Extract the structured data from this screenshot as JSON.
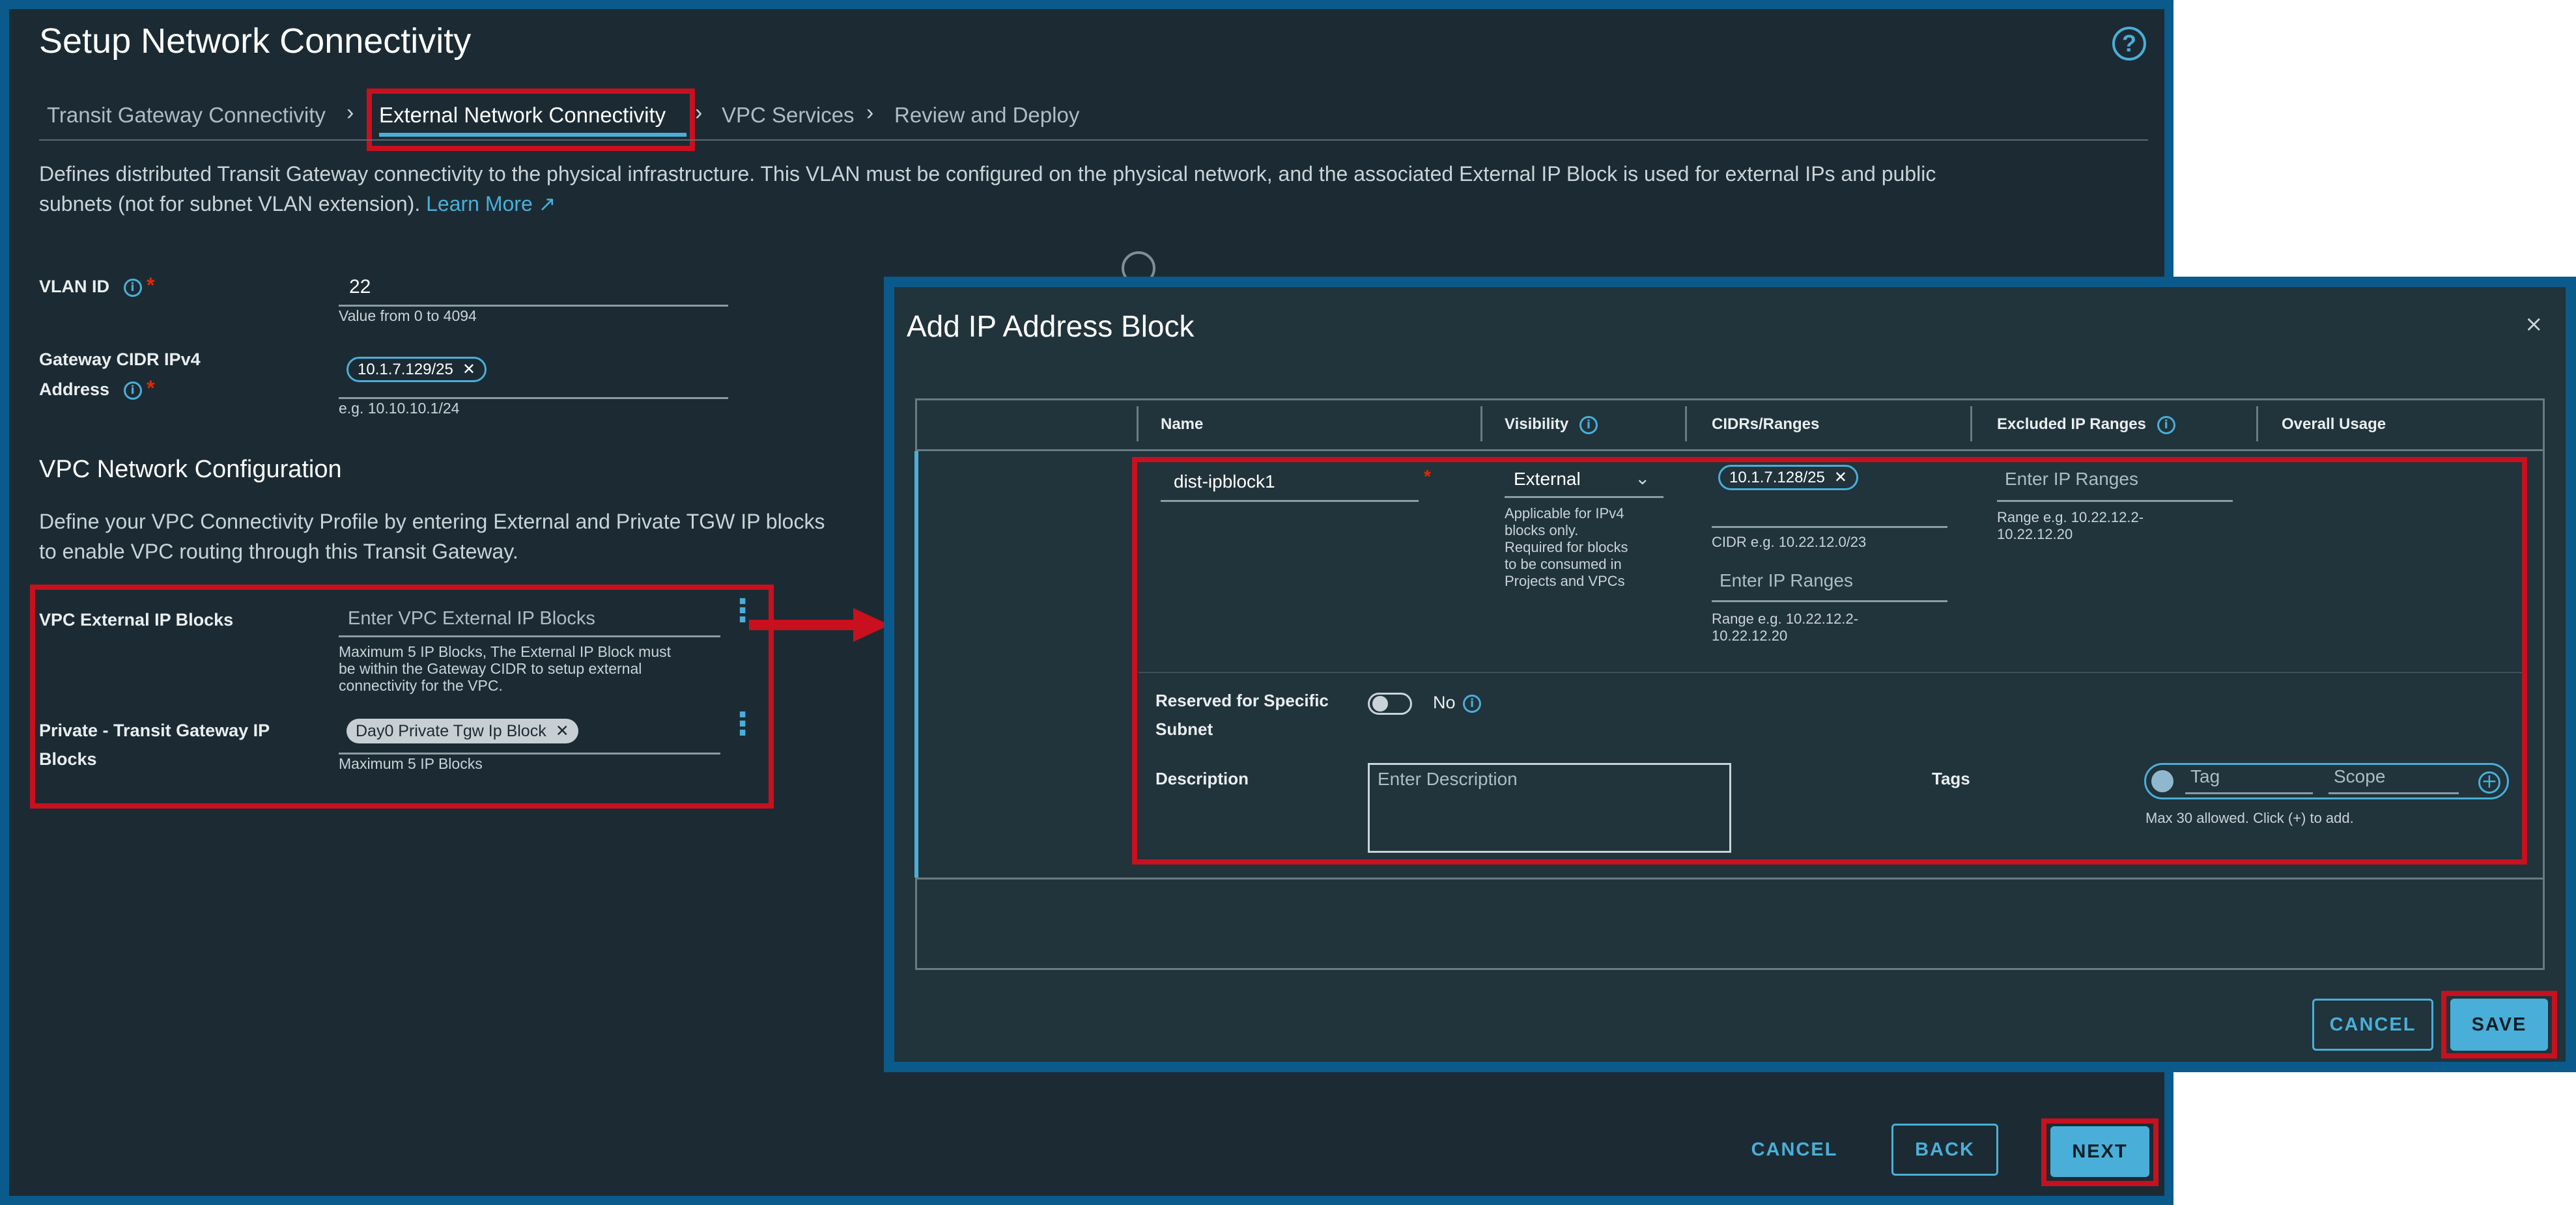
{
  "page": {
    "title": "Setup Network Connectivity",
    "help_icon": "question-circle-icon"
  },
  "stepper": {
    "steps": [
      "Transit Gateway Connectivity",
      "External Network Connectivity",
      "VPC Services",
      "Review and Deploy"
    ],
    "active": "External Network Connectivity"
  },
  "description": {
    "line1": "Defines distributed Transit Gateway connectivity to the physical infrastructure. This VLAN must be configured on the physical network, and the associated External IP Block is used for external IPs and public",
    "line2": "subnets (not for subnet VLAN extension).",
    "learn_more": "Learn More"
  },
  "form": {
    "vlan_label": "VLAN ID",
    "vlan_value": "22",
    "vlan_helper": "Value from 0 to 4094",
    "gateway_label_1": "Gateway CIDR IPv4",
    "gateway_label_2": "Address",
    "gateway_chip": "10.1.7.129/25",
    "gateway_helper": "e.g. 10.10.10.1/24",
    "required_mark": "*"
  },
  "vpc_section": {
    "title": "VPC Network Configuration",
    "desc1": "Define your VPC Connectivity Profile by entering External and Private TGW IP blocks",
    "desc2": "to enable VPC routing through this Transit Gateway.",
    "external_label": "VPC External IP Blocks",
    "external_placeholder": "Enter VPC External IP Blocks",
    "external_helper_1": "Maximum 5 IP Blocks, The External IP Block must",
    "external_helper_2": "be within the Gateway CIDR to setup external",
    "external_helper_3": "connectivity for the VPC.",
    "private_label_1": "Private - Transit Gateway IP",
    "private_label_2": "Blocks",
    "private_chip": "Day0 Private Tgw Ip Block",
    "private_helper": "Maximum 5 IP Blocks"
  },
  "footer": {
    "cancel": "CANCEL",
    "back": "BACK",
    "next": "NEXT"
  },
  "modal": {
    "title": "Add IP Address Block",
    "close_icon": "close-icon",
    "headers": [
      "Name",
      "Visibility",
      "CIDRs/Ranges",
      "Excluded IP Ranges",
      "Overall Usage"
    ],
    "name_value": "dist-ipblock1",
    "visibility_value": "External",
    "visibility_note_1": "Applicable for IPv4",
    "visibility_note_2": "blocks only.",
    "visibility_note_3": "Required for blocks",
    "visibility_note_4": "to be consumed in",
    "visibility_note_5": "Projects and VPCs",
    "cidr_chip": "10.1.7.128/25",
    "cidr_helper": "CIDR e.g. 10.22.12.0/23",
    "ranges_placeholder": "Enter IP Ranges",
    "ranges_helper_1": "Range e.g. 10.22.12.2-",
    "ranges_helper_2": "10.22.12.20",
    "excluded_placeholder": "Enter IP Ranges",
    "excluded_helper_1": "Range e.g. 10.22.12.2-",
    "excluded_helper_2": "10.22.12.20",
    "reserved_label_1": "Reserved for Specific",
    "reserved_label_2": "Subnet",
    "reserved_toggle_value": "No",
    "description_label": "Description",
    "description_placeholder": "Enter Description",
    "tags_label": "Tags",
    "tag_placeholder": "Tag",
    "scope_placeholder": "Scope",
    "tags_helper": "Max 30 allowed. Click (+) to add.",
    "cancel": "CANCEL",
    "save": "SAVE"
  },
  "colors": {
    "accent": "#49afd9",
    "highlight_box": "#c8101e",
    "frame": "#0b5a8c",
    "background": "#1c2b33"
  }
}
